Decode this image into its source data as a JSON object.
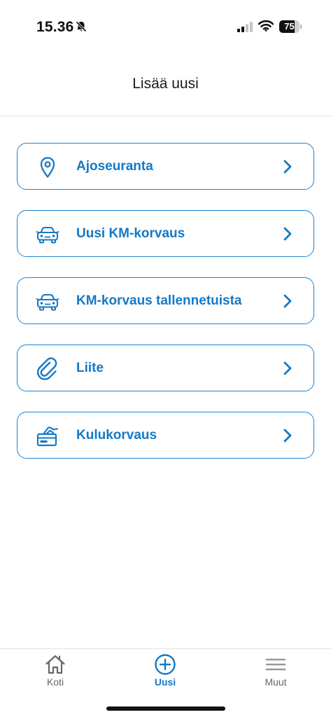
{
  "status_bar": {
    "time": "15.36",
    "battery_level": "75",
    "battery_fraction": 0.75
  },
  "header": {
    "title": "Lisää uusi"
  },
  "menu": {
    "items": [
      {
        "label": "Ajoseuranta",
        "icon": "location-pin-icon"
      },
      {
        "label": "Uusi KM-korvaus",
        "icon": "car-icon"
      },
      {
        "label": "KM-korvaus tallennetuista",
        "icon": "car-icon"
      },
      {
        "label": "Liite",
        "icon": "paperclip-icon"
      },
      {
        "label": "Kulukorvaus",
        "icon": "receipt-hand-icon"
      }
    ]
  },
  "tab_bar": {
    "tabs": [
      {
        "label": "Koti",
        "icon": "home-icon",
        "active": false
      },
      {
        "label": "Uusi",
        "icon": "plus-circle-icon",
        "active": true
      },
      {
        "label": "Muut",
        "icon": "menu-icon",
        "active": false
      }
    ]
  },
  "colors": {
    "accent": "#1479c6",
    "border": "#1b86d2",
    "inactive_tab": "#666666"
  }
}
